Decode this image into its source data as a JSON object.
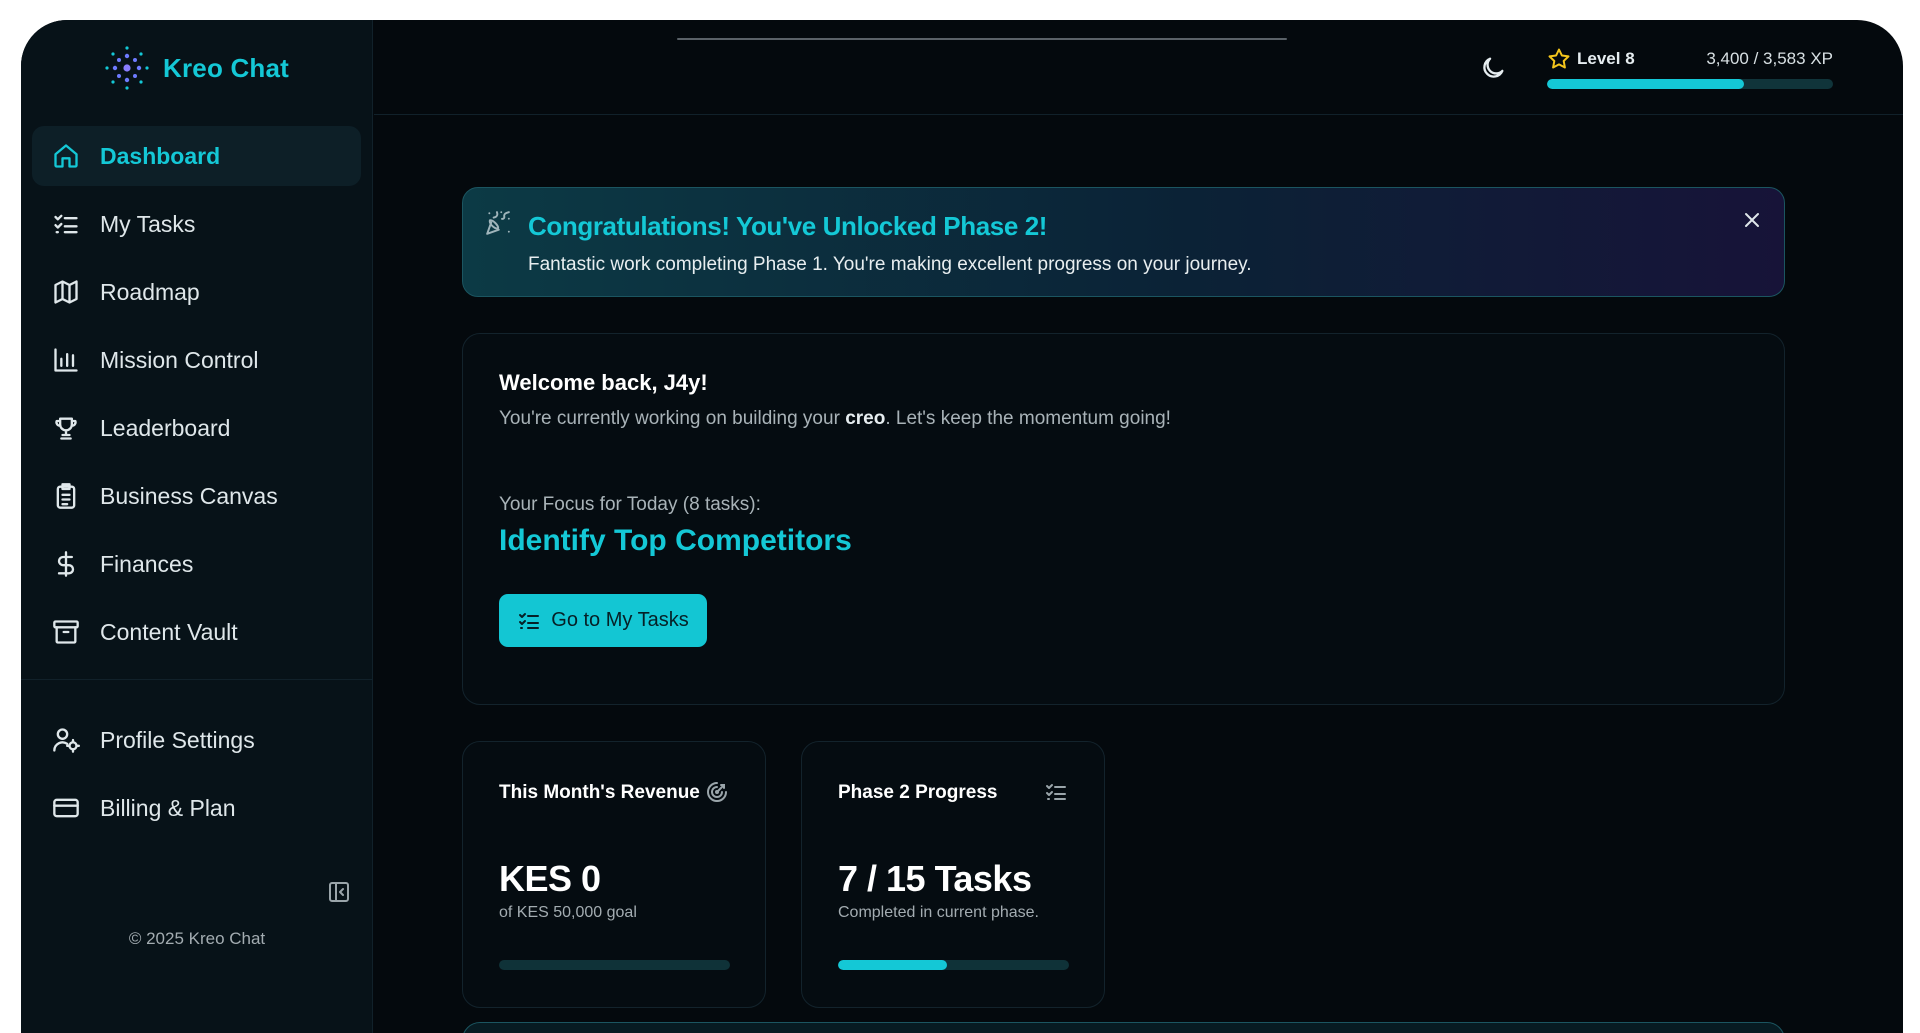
{
  "brand": {
    "name": "Kreo Chat"
  },
  "sidebar": {
    "items": [
      {
        "label": "Dashboard",
        "icon": "home-icon",
        "active": true
      },
      {
        "label": "My Tasks",
        "icon": "list-checks-icon"
      },
      {
        "label": "Roadmap",
        "icon": "map-icon"
      },
      {
        "label": "Mission Control",
        "icon": "bar-chart-icon"
      },
      {
        "label": "Leaderboard",
        "icon": "trophy-icon"
      },
      {
        "label": "Business Canvas",
        "icon": "clipboard-icon"
      },
      {
        "label": "Finances",
        "icon": "dollar-icon"
      },
      {
        "label": "Content Vault",
        "icon": "archive-icon"
      }
    ],
    "secondary": [
      {
        "label": "Profile Settings",
        "icon": "user-cog-icon"
      },
      {
        "label": "Billing & Plan",
        "icon": "credit-card-icon"
      }
    ],
    "copyright": "© 2025 Kreo Chat"
  },
  "header": {
    "level_label": "Level 8",
    "xp_text": "3,400 / 3,583 XP",
    "xp_progress": 0.69
  },
  "banner": {
    "title": "Congratulations! You've Unlocked Phase 2!",
    "text": "Fantastic work completing Phase 1. You're making excellent progress on your journey."
  },
  "welcome": {
    "title": "Welcome back, J4y!",
    "sub_before": "You're currently working on building your ",
    "sub_bold": "creo",
    "sub_after": ". Let's keep the momentum going!",
    "focus_label": "Your Focus for Today (8 tasks):",
    "focus_task": "Identify Top Competitors",
    "button_label": "Go to My Tasks"
  },
  "stats": [
    {
      "title": "This Month's Revenue",
      "icon": "target-icon",
      "value": "KES 0",
      "sub": "of KES 50,000 goal",
      "progress": 0
    },
    {
      "title": "Phase 2 Progress",
      "icon": "list-checks-icon",
      "value": "7 / 15 Tasks",
      "sub": "Completed in current phase.",
      "progress": 0.47
    }
  ],
  "colors": {
    "accent": "#14c8d6",
    "background": "#04090d",
    "sidebar": "#071218",
    "avatar": "#f4c51c"
  }
}
